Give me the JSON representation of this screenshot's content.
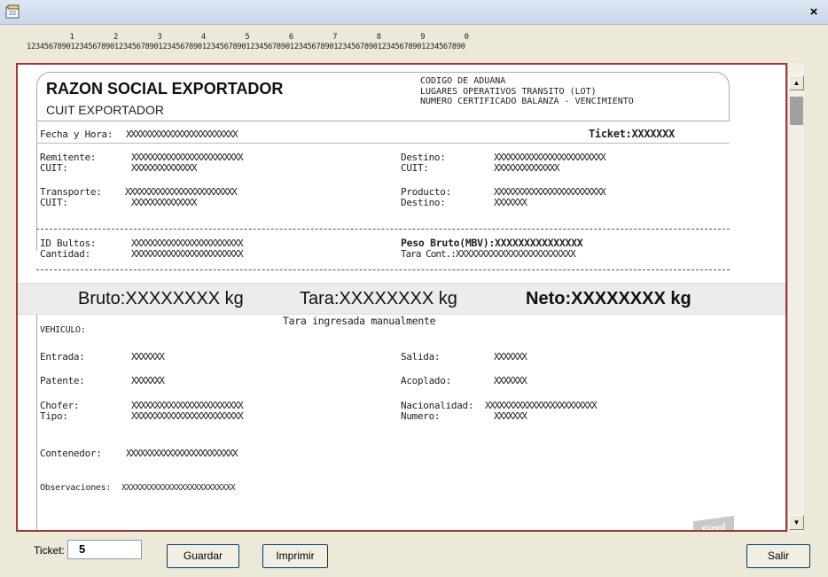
{
  "window": {
    "close_glyph": "×",
    "icon": "window-app-icon"
  },
  "ruler": {
    "tens": "         1         2         3         4         5         6         7         8         9         0",
    "digits": "1234567890123456789012345678901234567890123456789012345678901234567890123456789012345678901234567890"
  },
  "ticket": {
    "header": {
      "company": "RAZON SOCIAL EXPORTADOR",
      "cuit": "CUIT EXPORTADOR",
      "right_lines": [
        "CODIGO DE ADUANA",
        "LUGARES OPERATIVOS TRANSITO (LOT)",
        "NUMERO CERTIFICADO BALANZA - VENCIMIENTO"
      ]
    },
    "fecha_label": "Fecha y Hora:",
    "fecha_value": "XXXXXXXXXXXXXXXXXXXXXXXX",
    "ticket_label": "Ticket:XXXXXXX",
    "remitente_label": "Remitente:",
    "remitente_value": "XXXXXXXXXXXXXXXXXXXXXXXX",
    "cuit1_label": "CUIT:",
    "cuit1_value": "XXXXXXXXXXXXXX",
    "destino_label": "Destino:",
    "destino_value": "XXXXXXXXXXXXXXXXXXXXXXXX",
    "cuit2_label": "CUIT:",
    "cuit2_value": "XXXXXXXXXXXXXX",
    "transporte_label": "Transporte:",
    "transporte_value": "XXXXXXXXXXXXXXXXXXXXXXXX",
    "cuit3_label": "CUIT:",
    "cuit3_value": "XXXXXXXXXXXXXX",
    "producto_label": "Producto:",
    "producto_value": "XXXXXXXXXXXXXXXXXXXXXXXX",
    "destino2_label": "Destino:",
    "destino2_value": "XXXXXXX",
    "bultos_label": "ID Bultos:",
    "bultos_value": "XXXXXXXXXXXXXXXXXXXXXXXX",
    "cantidad_label": "Cantidad:",
    "cantidad_value": "XXXXXXXXXXXXXXXXXXXXXXXX",
    "peso_bruto": "Peso Bruto(MBV):XXXXXXXXXXXXXXX",
    "tara_cont": "Tara Cont.:XXXXXXXXXXXXXXXXXXXXXXXX",
    "totals": {
      "bruto": "Bruto:XXXXXXXX kg",
      "tara": "Tara:XXXXXXXX kg",
      "neto": "Neto:XXXXXXXX kg"
    },
    "tara_note": "Tara ingresada manualmente",
    "vehiculo_label": "VEHICULO:",
    "entrada_label": "Entrada:",
    "entrada_value": "XXXXXXX",
    "salida_label": "Salida:",
    "salida_value": "XXXXXXX",
    "patente_label": "Patente:",
    "patente_value": "XXXXXXX",
    "acoplado_label": "Acoplado:",
    "acoplado_value": "XXXXXXX",
    "chofer_label": "Chofer:",
    "chofer_value": "XXXXXXXXXXXXXXXXXXXXXXXX",
    "tipo_label": "Tipo:",
    "tipo_value": "XXXXXXXXXXXXXXXXXXXXXXXX",
    "nacionalidad_label": "Nacionalidad:",
    "nacionalidad_value": "XXXXXXXXXXXXXXXXXXXXXXXX",
    "numero_label": "Numero:",
    "numero_value": "XXXXXXX",
    "contenedor_label": "Contenedor:",
    "contenedor_value": "XXXXXXXXXXXXXXXXXXXXXXXX",
    "observaciones_label": "Observaciones:",
    "observaciones_value": "XXXXXXXXXXXXXXXXXXXXXXXXX",
    "stamp": "Sinol"
  },
  "controls": {
    "ticket_label": "Ticket:",
    "ticket_value": "5",
    "guardar": "Guardar",
    "imprimir": "Imprimir",
    "salir": "Salir"
  }
}
